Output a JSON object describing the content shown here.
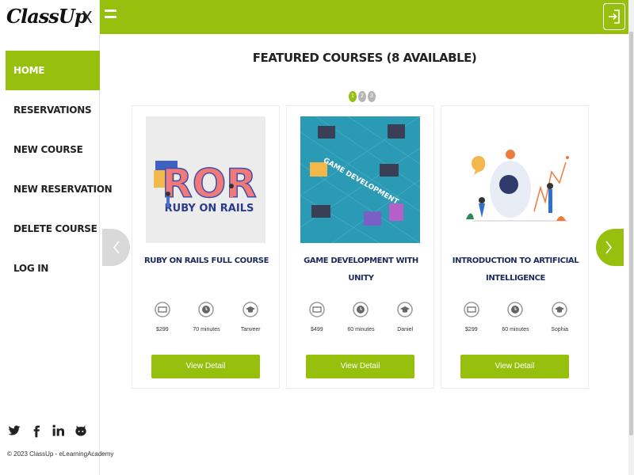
{
  "app": {
    "logo_text": "ClassUp",
    "close_label": "X"
  },
  "sidebar": {
    "items": [
      {
        "label": "HOME",
        "active": true
      },
      {
        "label": "RESERVATIONS"
      },
      {
        "label": "NEW COURSE"
      },
      {
        "label": "NEW RESERVATION"
      },
      {
        "label": "DELETE COURSE"
      },
      {
        "label": "LOG IN"
      }
    ],
    "social_icons": [
      "twitter-icon",
      "facebook-icon",
      "linkedin-icon",
      "github-icon"
    ],
    "copyright": "© 2023 ClassUp - eLearningAcademy"
  },
  "topbar": {
    "menu_icon": "hamburger-icon",
    "login_icon": "sign-in-icon"
  },
  "main": {
    "heading": "FEATURED COURSES (8 AVAILABLE)",
    "pages": [
      "1",
      "2",
      "3"
    ],
    "active_page": 1,
    "prev_icon": "chevron-left-icon",
    "next_icon": "chevron-right-icon",
    "courses": [
      {
        "title": "RUBY ON RAILS FULL COURSE",
        "image_text_big": "ROR",
        "image_text_small": "RUBY ON RAILS",
        "price": "$299",
        "duration": "70 minutes",
        "instructor": "Tanveer",
        "button": "View Detail"
      },
      {
        "title": "GAME DEVELOPMENT WITH UNITY",
        "image_text_big": "GAME DEVELOPMENT",
        "price": "$499",
        "duration": "60 minutes",
        "instructor": "Daniel",
        "button": "View Detail"
      },
      {
        "title": "INTRODUCTION TO ARTIFICIAL INTELLIGENCE",
        "price": "$299",
        "duration": "60 minutes",
        "instructor": "Sophia",
        "button": "View Detail"
      }
    ]
  },
  "colors": {
    "accent": "#97bf0d",
    "title_navy": "#1b2a5a",
    "inactive_gray": "#b5b5b5"
  }
}
